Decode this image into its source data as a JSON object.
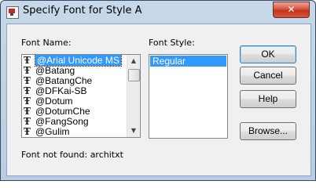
{
  "window": {
    "title": "Specify Font for Style A",
    "close_symbol": "✕"
  },
  "font_name": {
    "label": "Font Name:",
    "items": [
      "@Arial Unicode MS",
      "@Batang",
      "@BatangChe",
      "@DFKai-SB",
      "@Dotum",
      "@DotumChe",
      "@FangSong",
      "@Gulim"
    ],
    "selected_index": 0,
    "icon": "truetype-font-icon"
  },
  "font_style": {
    "label": "Font Style:",
    "items": [
      "Regular"
    ],
    "selected_index": 0
  },
  "buttons": {
    "ok": "OK",
    "cancel": "Cancel",
    "help": "Help",
    "browse": "Browse..."
  },
  "status": {
    "message": "Font not found: architxt"
  }
}
